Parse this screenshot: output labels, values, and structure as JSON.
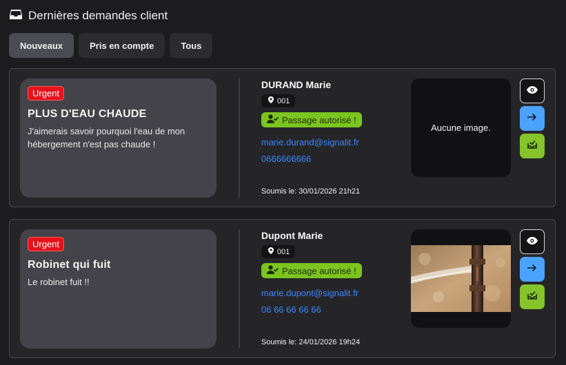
{
  "header": {
    "title": "Dernières demandes client",
    "icon": "inbox-icon"
  },
  "tabs": [
    {
      "label": "Nouveaux",
      "active": true
    },
    {
      "label": "Pris en compte",
      "active": false
    },
    {
      "label": "Tous",
      "active": false
    }
  ],
  "requests": [
    {
      "badge": "Urgent",
      "title": "PLUS D'EAU CHAUDE",
      "description": "J'aimerais savoir pourquoi l'eau de mon hébergement n'est pas chaude !",
      "client_name": "DURAND Marie",
      "unit": "001",
      "authorization": "Passage autorisé !",
      "email": "marie.durand@signalit.fr",
      "phone": "0666666666",
      "submitted": "Soumis le: 30/01/2026 21h21",
      "image_text": "Aucune image."
    },
    {
      "badge": "Urgent",
      "title": "Robinet qui fuit",
      "description": "Le robinet fuit !!",
      "client_name": "Dupont Marie",
      "unit": "001",
      "authorization": "Passage autorisé !",
      "email": "marie.dupont@signalit.fr",
      "phone": "06 66 66 66 66",
      "submitted": "Soumis le: 24/01/2026 19h24",
      "image": "leaking-pipe-photo"
    }
  ],
  "colors": {
    "urgent": "#e5121b",
    "authorized": "#7cc520",
    "link": "#3a86ff",
    "action_go": "#4ba3ff",
    "action_take": "#86c42b"
  }
}
